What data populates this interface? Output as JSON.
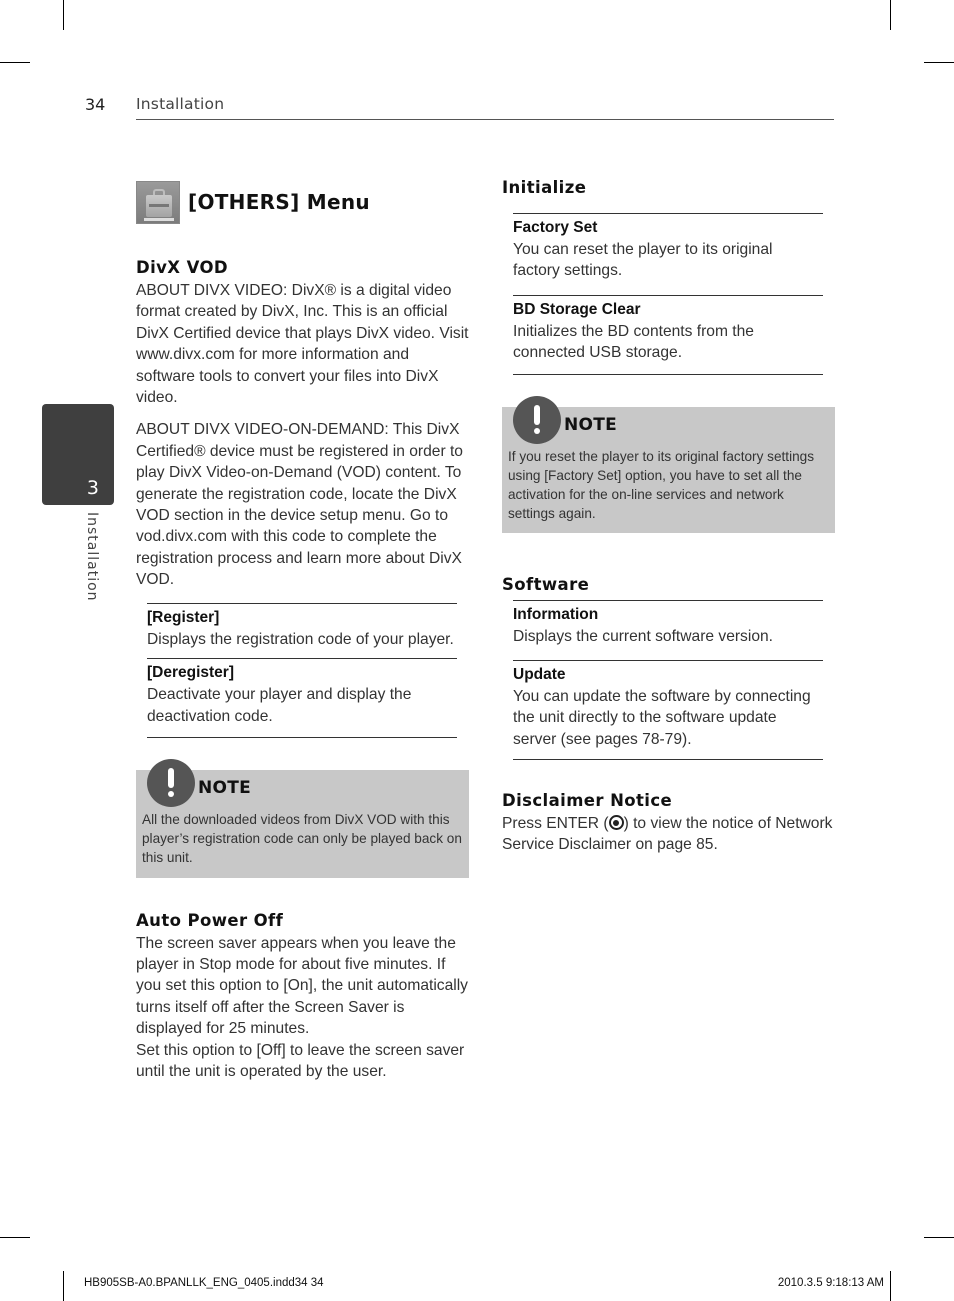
{
  "header": {
    "page_number": "34",
    "section": "Installation"
  },
  "side_tab": {
    "chapter_number": "3",
    "label": "Installation"
  },
  "menu": {
    "icon": "others-menu-icon",
    "title": "[OTHERS] Menu"
  },
  "divx_vod": {
    "heading": "DivX VOD",
    "paragraphs": [
      "ABOUT DIVX VIDEO: DivX® is a digital video format created by DivX, Inc. This is an official DivX Certified device that plays DivX video. Visit www.divx.com for more information and software tools to convert your files into DivX video.",
      "ABOUT DIVX VIDEO-ON-DEMAND: This DivX Certified® device must be registered in order to play DivX Video-on-Demand (VOD) content. To generate the registration code, locate the DivX VOD section in the device setup menu. Go to vod.divx.com with this code to complete the registration process and learn more about DivX VOD."
    ],
    "items": [
      {
        "title": "[Register]",
        "desc": "Displays the registration code of your player."
      },
      {
        "title": "[Deregister]",
        "desc": "Deactivate your player and display the deactivation code."
      }
    ],
    "note": {
      "icon": "exclamation-icon",
      "label": "NOTE",
      "text": "All the downloaded videos from DivX VOD with this player’s registration code can only be played back on this unit."
    }
  },
  "auto_power_off": {
    "heading": "Auto Power Off",
    "text_lines": [
      "The screen saver appears when you leave the player in Stop mode for about five minutes. If you set this option to [On], the unit automatically turns itself off after the Screen Saver is displayed for 25 minutes.",
      "Set this option to [Off] to leave the screen saver until the unit is operated by the user."
    ]
  },
  "initialize": {
    "heading": "Initialize",
    "items": [
      {
        "title": "Factory Set",
        "desc": "You can reset the player to its original factory settings."
      },
      {
        "title": "BD Storage Clear",
        "desc": "Initializes the BD contents from the connected USB storage."
      }
    ],
    "note": {
      "icon": "exclamation-icon",
      "label": "NOTE",
      "text": "If you reset the player to its original factory settings using [Factory Set] option, you have to set all the activation for the on-line services and network settings again."
    }
  },
  "software": {
    "heading": "Software",
    "items": [
      {
        "title": "Information",
        "desc": "Displays the current software version."
      },
      {
        "title": "Update",
        "desc": "You can update the software by connecting the unit directly to the software update server (see pages 78-79)."
      }
    ]
  },
  "disclaimer": {
    "heading": "Disclaimer Notice",
    "text_before_icon": "Press ENTER (",
    "icon": "enter-button-icon",
    "text_after_icon": ") to view the notice of Network Service Disclaimer on page 85."
  },
  "footer": {
    "file_info": "HB905SB-A0.BPANLLK_ENG_0405.indd34   34",
    "timestamp": "2010.3.5   9:18:13 AM"
  }
}
